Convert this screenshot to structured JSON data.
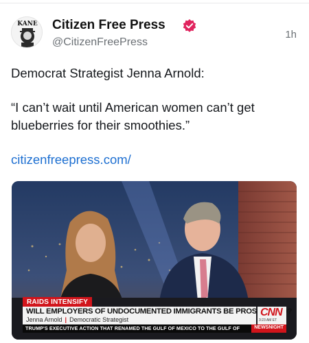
{
  "author": {
    "display_name": "Citizen Free Press",
    "handle": "@CitizenFreePress",
    "avatar_text": "KANE",
    "verified": true
  },
  "timestamp": "1h",
  "post": {
    "line1": "Democrat Strategist Jenna Arnold:",
    "quote": "“I can’t wait until American women can’t get blueberries for their smoothies.”",
    "link": "citizenfreepress.com/"
  },
  "media": {
    "tag": "RAIDS INTENSIFY",
    "headline": "WILL EMPLOYERS OF UNDOCUMENTED IMMIGRANTS BE PROSECUTED?",
    "guest_name": "Jenna Arnold",
    "guest_separator": "|",
    "guest_title": "Democratic Strategist",
    "network_logo": "CNN",
    "time": "3:23 AM ET",
    "ticker": "TRUMP'S EXECUTIVE ACTION THAT RENAMED THE GULF OF MEXICO TO THE GULF OF",
    "ticker_badge": "NEWSNIGHT"
  },
  "colors": {
    "link": "#1d6fd1",
    "verified_badge": "#e0245e",
    "cnn_red": "#d1141b"
  }
}
